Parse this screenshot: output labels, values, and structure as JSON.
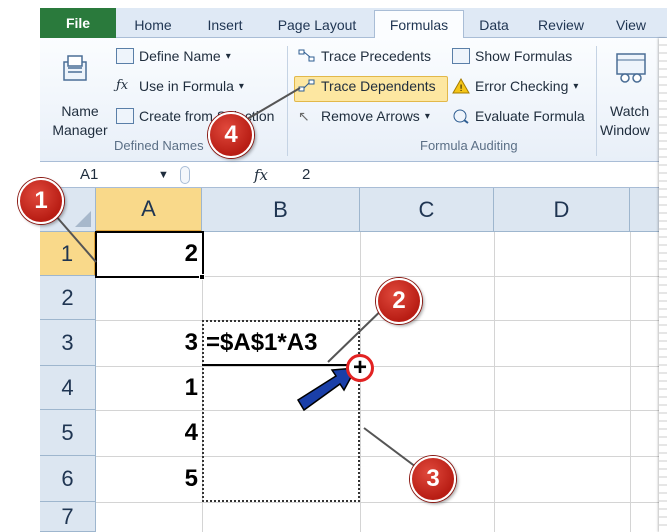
{
  "tabs": {
    "file": "File",
    "home": "Home",
    "insert": "Insert",
    "page_layout": "Page Layout",
    "formulas": "Formulas",
    "data": "Data",
    "review": "Review",
    "view": "View"
  },
  "ribbon": {
    "name_manager_line1": "Name",
    "name_manager_line2": "Manager",
    "define_name": "Define Name",
    "use_in_formula": "Use in Formula",
    "create_from_selection": "Create from Selection",
    "defined_names_label": "Defined Names",
    "trace_precedents": "Trace Precedents",
    "trace_dependents": "Trace Dependents",
    "remove_arrows": "Remove Arrows",
    "show_formulas": "Show Formulas",
    "error_checking": "Error Checking",
    "evaluate_formula": "Evaluate Formula",
    "formula_auditing_label": "Formula Auditing",
    "watch_window_line1": "Watch",
    "watch_window_line2": "Window"
  },
  "formula_bar": {
    "name_box": "A1",
    "fx": "fx",
    "content": "2"
  },
  "grid": {
    "columns": [
      "A",
      "B",
      "C",
      "D"
    ],
    "rows": [
      "1",
      "2",
      "3",
      "4",
      "5",
      "6",
      "7"
    ],
    "cells": {
      "A1": "2",
      "A3": "3",
      "A4": "1",
      "A5": "4",
      "A6": "5",
      "B3": "=$A$1*A3"
    }
  },
  "callouts": [
    "1",
    "2",
    "3",
    "4"
  ],
  "fill_handle_symbol": "+",
  "colors": {
    "file_tab": "#2a7a3c",
    "callout": "#c62a1f",
    "highlight": "#fde7a1",
    "selected_header": "#f9d98a",
    "arrow": "#1a3fa8"
  }
}
